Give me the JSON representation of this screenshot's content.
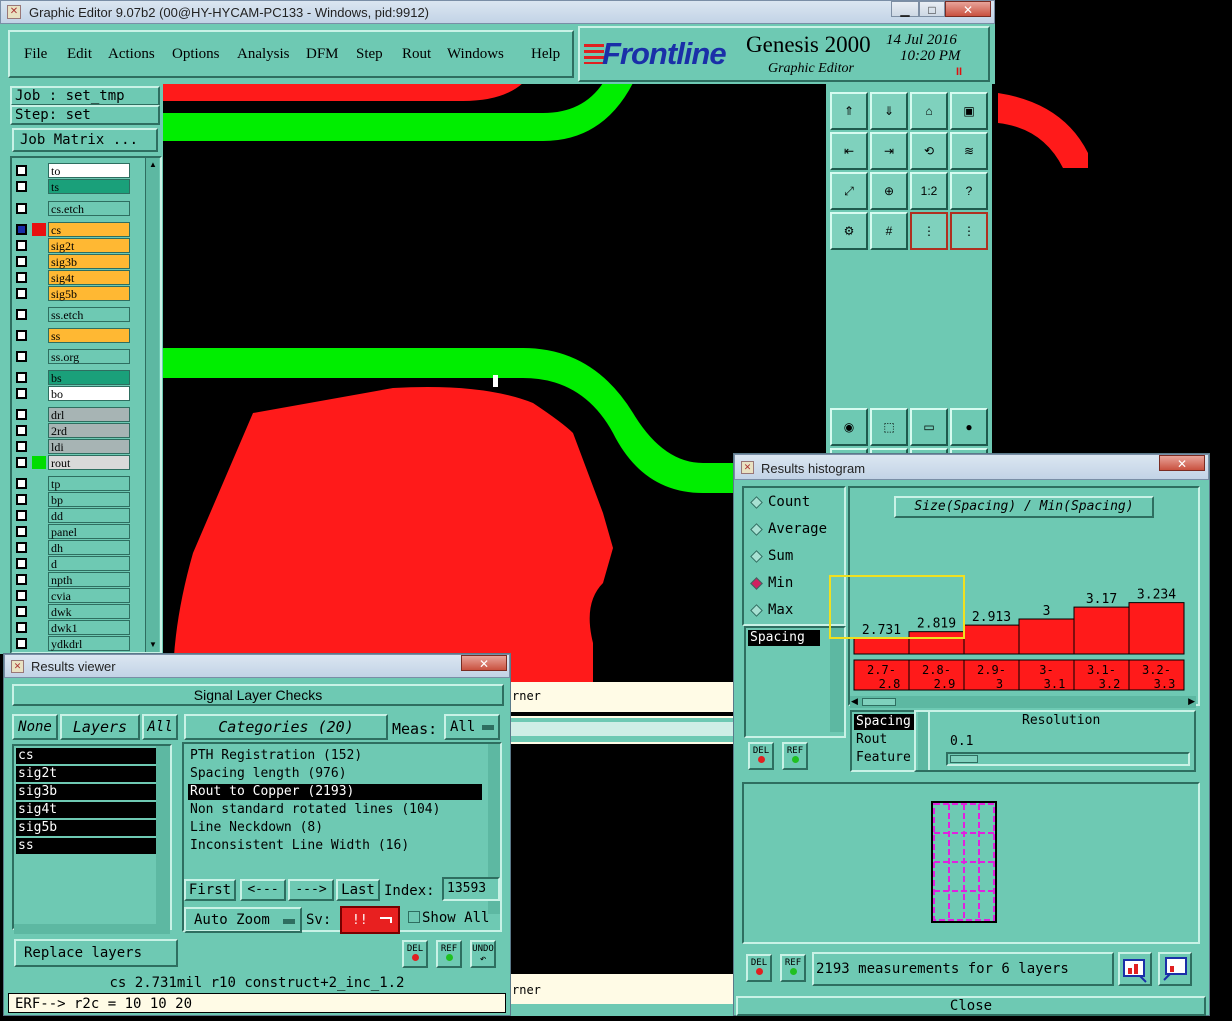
{
  "main_window": {
    "title": "Graphic Editor 9.07b2 (00@HY-HYCAM-PC133 - Windows, pid:9912)",
    "menu": [
      "File",
      "Edit",
      "Actions",
      "Options",
      "Analysis",
      "DFM",
      "Step",
      "Rout",
      "Windows",
      "Help"
    ],
    "brand": "Frontline",
    "product": "Genesis 2000",
    "subtitle": "Graphic Editor",
    "date": "14 Jul 2016",
    "time": "10:20 PM",
    "pause_glyph": "II"
  },
  "job": {
    "job_label": "Job : set_tmp",
    "step_label": "Step: set",
    "matrix_button": "Job Matrix ..."
  },
  "layers": [
    {
      "name": "to",
      "bg": "#ffffff"
    },
    {
      "name": "ts",
      "bg": "#1aa07a"
    },
    {
      "name": "cs.etch",
      "bg": "#6ec9b3"
    },
    {
      "name": "cs",
      "bg": "#ffb833"
    },
    {
      "name": "sig2t",
      "bg": "#ffb833"
    },
    {
      "name": "sig3b",
      "bg": "#ffb833"
    },
    {
      "name": "sig4t",
      "bg": "#ffb833"
    },
    {
      "name": "sig5b",
      "bg": "#ffb833"
    },
    {
      "name": "ss.etch",
      "bg": "#6ec9b3"
    },
    {
      "name": "ss",
      "bg": "#ffb833"
    },
    {
      "name": "ss.org",
      "bg": "#6ec9b3"
    },
    {
      "name": "bs",
      "bg": "#1aa07a"
    },
    {
      "name": "bo",
      "bg": "#ffffff"
    },
    {
      "name": "drl",
      "bg": "#a7b4b4"
    },
    {
      "name": "2rd",
      "bg": "#a7b4b4"
    },
    {
      "name": "ldi",
      "bg": "#a7b4b4"
    },
    {
      "name": "rout",
      "bg": "#d9d9d9"
    },
    {
      "name": "tp",
      "bg": "#6ec9b3"
    },
    {
      "name": "bp",
      "bg": "#6ec9b3"
    },
    {
      "name": "dd",
      "bg": "#6ec9b3"
    },
    {
      "name": "panel",
      "bg": "#6ec9b3"
    },
    {
      "name": "dh",
      "bg": "#6ec9b3"
    },
    {
      "name": "d",
      "bg": "#6ec9b3"
    },
    {
      "name": "npth",
      "bg": "#6ec9b3"
    },
    {
      "name": "cvia",
      "bg": "#6ec9b3"
    },
    {
      "name": "dwk",
      "bg": "#6ec9b3"
    },
    {
      "name": "dwk1",
      "bg": "#6ec9b3"
    },
    {
      "name": "ydkdrl",
      "bg": "#6ec9b3"
    }
  ],
  "status": {
    "line1_tail": "rner",
    "line2_tail": "rner",
    "measure_line": "cs 2.731mil  r10  construct+2_inc_1.2",
    "erf_line": "ERF--> r2c = 10 10 20"
  },
  "results_viewer": {
    "title": "Results viewer",
    "header": "Signal Layer Checks",
    "none_btn": "None",
    "layers_btn": "Layers",
    "all_btn": "All",
    "layer_list": [
      "cs",
      "sig2t",
      "sig3b",
      "sig4t",
      "sig5b",
      "ss"
    ],
    "categories_label": "Categories (20)",
    "meas_label": "Meas:",
    "meas_value": "All",
    "categories": [
      {
        "text": "PTH Registration (152)",
        "selected": false
      },
      {
        "text": "Spacing length (976)",
        "selected": false
      },
      {
        "text": "Rout to Copper (2193)",
        "selected": true
      },
      {
        "text": "Non standard rotated lines (104)",
        "selected": false
      },
      {
        "text": "Line Neckdown (8)",
        "selected": false
      },
      {
        "text": "Inconsistent Line Width (16)",
        "selected": false
      }
    ],
    "nav": {
      "first": "First",
      "prev": "<---",
      "next": "--->",
      "last": "Last",
      "index_label": "Index:",
      "index_value": "13593"
    },
    "auto_zoom": "Auto Zoom",
    "sv_label": "Sv:",
    "sv_value": "!!",
    "show_all": "Show All",
    "replace_layers": "Replace layers",
    "del": "DEL",
    "ref": "REF",
    "undo": "UNDO"
  },
  "histogram": {
    "title": "Results histogram",
    "options": [
      {
        "label": "Count",
        "selected": false
      },
      {
        "label": "Average",
        "selected": false
      },
      {
        "label": "Sum",
        "selected": false
      },
      {
        "label": "Min",
        "selected": true
      },
      {
        "label": "Max",
        "selected": false
      }
    ],
    "measure_list": [
      "Spacing"
    ],
    "chart_title": "Size(Spacing) / Min(Spacing)",
    "sort_list": [
      "Spacing",
      "Rout",
      "Feature"
    ],
    "resolution_label": "Resolution",
    "resolution_value": "0.1",
    "summary": "2193 measurements for 6 layers",
    "close": "Close",
    "del": "DEL",
    "ref": "REF"
  },
  "chart_data": {
    "type": "bar",
    "title": "Size(Spacing) / Min(Spacing)",
    "categories": [
      "2.7-2.8",
      "2.8-2.9",
      "2.9-3",
      "3-3.1",
      "3.1-3.2",
      "3.2-3.3"
    ],
    "category_lines": [
      [
        "2.7-",
        "2.8"
      ],
      [
        "2.8-",
        "2.9"
      ],
      [
        "2.9-",
        "3"
      ],
      [
        "3-",
        "3.1"
      ],
      [
        "3.1-",
        "3.2"
      ],
      [
        "3.2-",
        "3.3"
      ]
    ],
    "values": [
      2.731,
      2.819,
      2.913,
      3,
      3.17,
      3.234
    ],
    "value_labels": [
      "2.731",
      "2.819",
      "2.913",
      "3",
      "3.17",
      "3.234"
    ],
    "ylim": [
      2.5,
      3.3
    ],
    "bar_color": "#ff1a1a",
    "highlight_color": "#f0e020"
  }
}
